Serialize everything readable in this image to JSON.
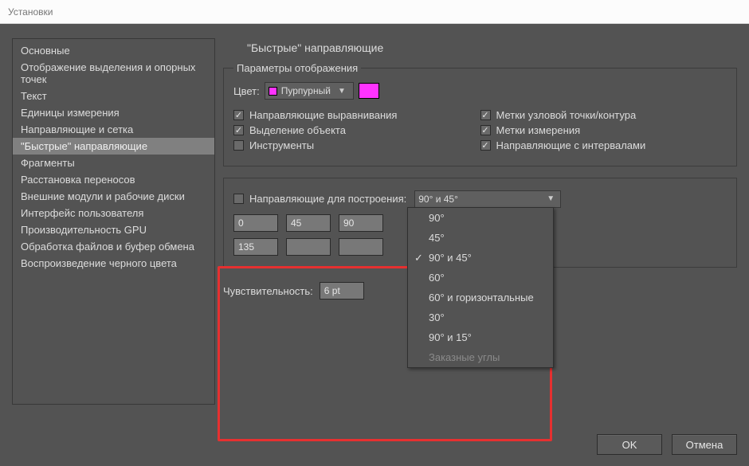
{
  "window": {
    "title": "Установки"
  },
  "sidebar": {
    "items": [
      {
        "label": "Основные"
      },
      {
        "label": "Отображение выделения и опорных точек"
      },
      {
        "label": "Текст"
      },
      {
        "label": "Единицы измерения"
      },
      {
        "label": "Направляющие и сетка"
      },
      {
        "label": "\"Быстрые\" направляющие"
      },
      {
        "label": "Фрагменты"
      },
      {
        "label": "Расстановка переносов"
      },
      {
        "label": "Внешние модули и рабочие диски"
      },
      {
        "label": "Интерфейс пользователя"
      },
      {
        "label": "Производительность GPU"
      },
      {
        "label": "Обработка файлов и буфер обмена"
      },
      {
        "label": "Воспроизведение черного цвета"
      }
    ],
    "active_index": 5
  },
  "panel": {
    "title": "\"Быстрые\" направляющие",
    "display": {
      "legend": "Параметры отображения",
      "color_label": "Цвет:",
      "color_name": "Пурпурный",
      "color_hex": "#ff33ff",
      "checks_left": [
        {
          "label": "Направляющие выравнивания",
          "checked": true
        },
        {
          "label": "Выделение объекта",
          "checked": true
        },
        {
          "label": "Инструменты",
          "checked": false
        }
      ],
      "checks_right": [
        {
          "label": "Метки узловой точки/контура",
          "checked": true
        },
        {
          "label": "Метки измерения",
          "checked": true
        },
        {
          "label": "Направляющие с интервалами",
          "checked": true
        }
      ]
    },
    "construction": {
      "checkbox_label": "Направляющие для построения:",
      "checkbox_checked": false,
      "selected": "90° и 45°",
      "options": [
        {
          "label": "90°"
        },
        {
          "label": "45°"
        },
        {
          "label": "90° и 45°",
          "selected": true
        },
        {
          "label": "60°"
        },
        {
          "label": "60° и горизонтальные"
        },
        {
          "label": "30°"
        },
        {
          "label": "90° и 15°"
        },
        {
          "label": "Заказные углы",
          "disabled": true
        }
      ],
      "angles": [
        "0",
        "45",
        "90",
        "135",
        "",
        ""
      ]
    },
    "sensitivity": {
      "label": "Чувствительность:",
      "value": "6 pt"
    }
  },
  "footer": {
    "ok": "OK",
    "cancel": "Отмена"
  }
}
